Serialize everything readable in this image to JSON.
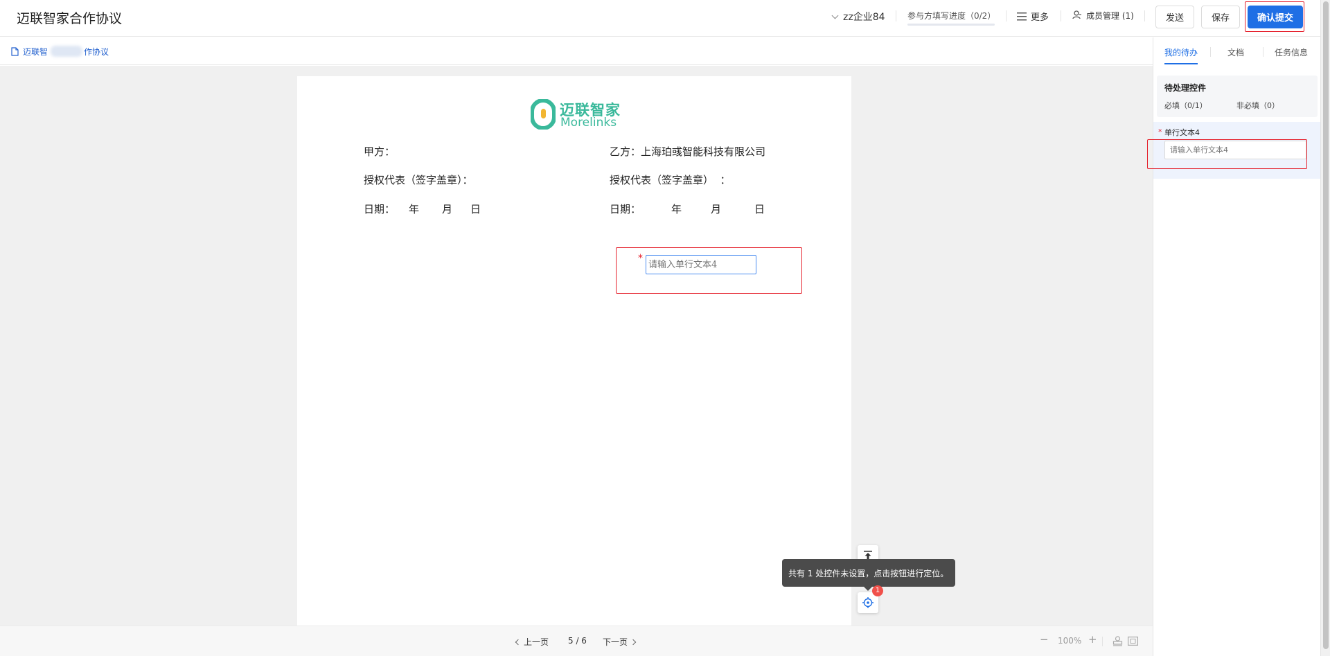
{
  "header": {
    "title": "迈联智家合作协议",
    "company": "zz企业84",
    "progress_label": "参与方填写进度（0/2）",
    "more_label": "更多",
    "members_label": "成员管理 (1)",
    "send_label": "发送",
    "save_label": "保存",
    "confirm_label": "确认提交"
  },
  "subbar": {
    "doc_name_left": "迈联智",
    "doc_name_right": "作协议"
  },
  "logo": {
    "cn": "迈联智家",
    "en": "Morelinks",
    "color": "#3ab99b"
  },
  "document": {
    "party_a": "甲方：",
    "party_b": "乙方：上海珀彧智能科技有限公司",
    "rep_a": "授权代表（签字盖章）：",
    "rep_b": "授权代表（签字盖章）  ：",
    "date_a_label": "日期：",
    "date_b_label": "日期：",
    "year": "年",
    "month": "月",
    "day": "日",
    "required_mark": "*",
    "field_placeholder": "请输入单行文本4"
  },
  "floating": {
    "tooltip": "共有 1 处控件未设置，点击按钮进行定位。",
    "badge_count": "1"
  },
  "pagination": {
    "prev": "上一页",
    "current": "5 / 6",
    "next": "下一页",
    "zoom": "100%",
    "zoom_out": "−",
    "zoom_in": "+"
  },
  "right_panel": {
    "tabs": [
      "我的待办",
      "文档",
      "任务信息"
    ],
    "pending_title": "待处理控件",
    "required_count": "必填（0/1）",
    "optional_count": "非必填（0）",
    "field_label": "单行文本4",
    "field_placeholder": "请输入单行文本4"
  },
  "colors": {
    "primary": "#1f6fe5",
    "highlight_red": "#e5202c",
    "badge_red": "#f0504a",
    "tooltip_bg": "#4b4b4b"
  }
}
